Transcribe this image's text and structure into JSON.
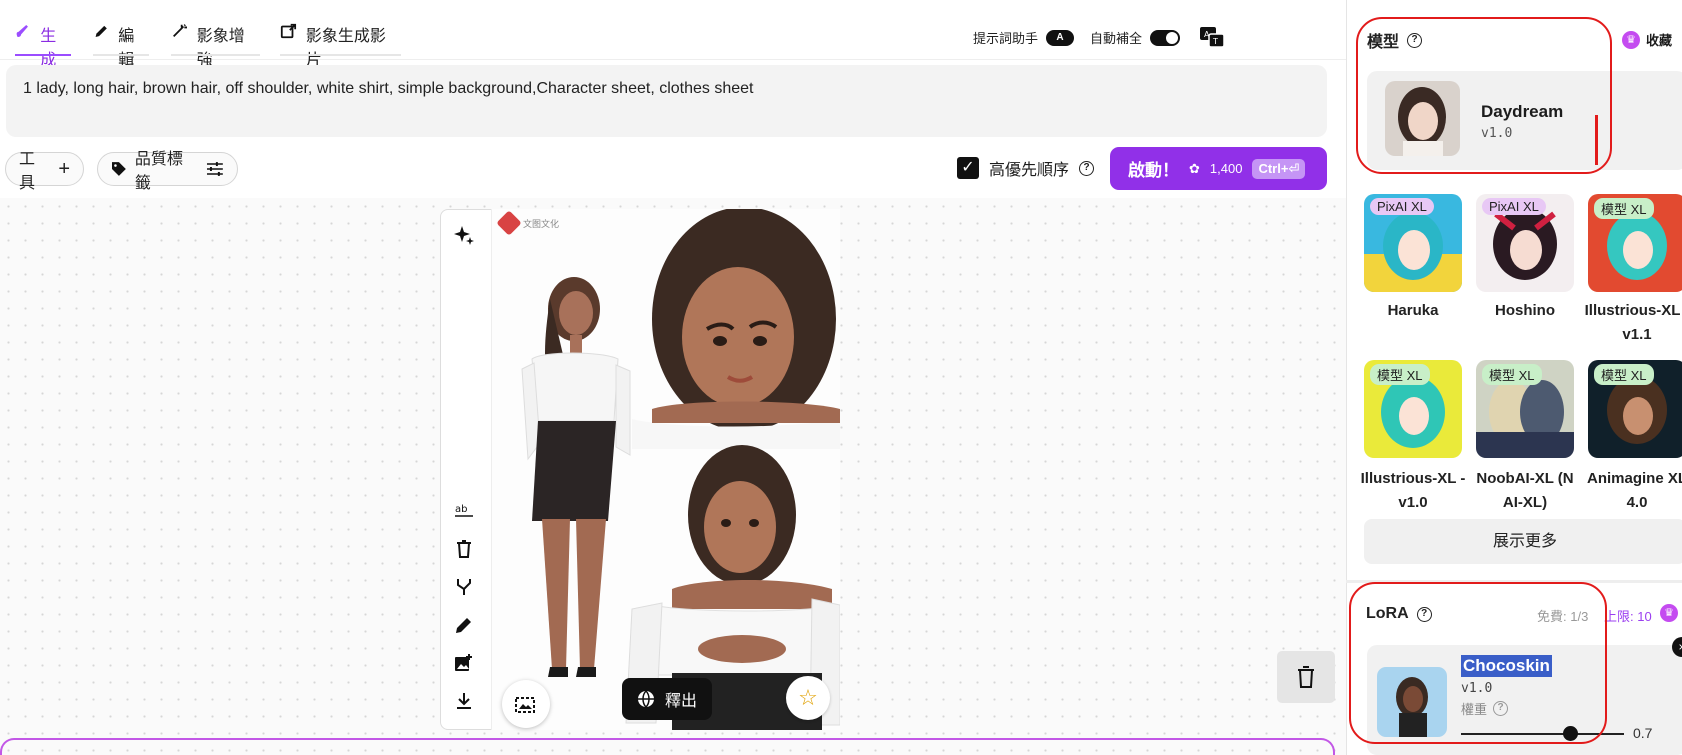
{
  "tabs": [
    {
      "label": "生成",
      "icon": "brush-icon",
      "active": true
    },
    {
      "label": "編輯",
      "icon": "pencil-icon",
      "active": false
    },
    {
      "label": "影象增強",
      "icon": "magic-wand-icon",
      "active": false
    },
    {
      "label": "影象生成影片",
      "icon": "video-export-icon",
      "active": false
    }
  ],
  "toolbar": {
    "prompt_assistant_label": "提示詞助手",
    "prompt_assistant_badge": "A",
    "auto_complete_label": "自動補全",
    "translate_icon": "translate-icon"
  },
  "prompt": {
    "text": "1 lady,  long hair, brown hair, off shoulder, white shirt, simple background,Character sheet, clothes sheet"
  },
  "actions": {
    "tools_label": "工具",
    "quality_tags_label": "品質標籤",
    "priority_label": "高優先順序",
    "priority_checked": true,
    "start_label": "啟動！",
    "start_cost": "1,400",
    "start_shortcut": "Ctrl+⏎"
  },
  "canvas": {
    "watermark_text": "文图文化",
    "release_label": "釋出"
  },
  "model_panel": {
    "title": "模型",
    "favorite_label": "收藏",
    "selected": {
      "name": "Daydream",
      "version": "v1.0"
    },
    "models": [
      {
        "badge": "PixAI XL",
        "name": "Haruka",
        "badge_color": "#e8c8f5"
      },
      {
        "badge": "PixAI XL",
        "name": "Hoshino",
        "badge_color": "#e8c8f5"
      },
      {
        "badge": "模型 XL",
        "name": "Illustrious-XL -v1.1",
        "badge_color": "#c8efc8"
      },
      {
        "badge": "模型 XL",
        "name": "Illustrious-XL -v1.0",
        "badge_color": "#c8efc8"
      },
      {
        "badge": "模型 XL",
        "name": "NoobAI-XL (N AI-XL)",
        "badge_color": "#c8efc8"
      },
      {
        "badge": "模型 XL",
        "name": "Animagine XL 4.0",
        "badge_color": "#c8efc8"
      }
    ],
    "show_more_label": "展示更多"
  },
  "lora_panel": {
    "title": "LoRA",
    "free_label": "免費: 1/3",
    "limit_label": "上限: 10",
    "item": {
      "name": "Chocoskin",
      "version": "v1.0",
      "weight_label": "權重",
      "weight_value": "0.7",
      "weight": 0.7
    }
  },
  "colors": {
    "accent": "#9130e8",
    "highlight_box": "#e21b1b"
  }
}
